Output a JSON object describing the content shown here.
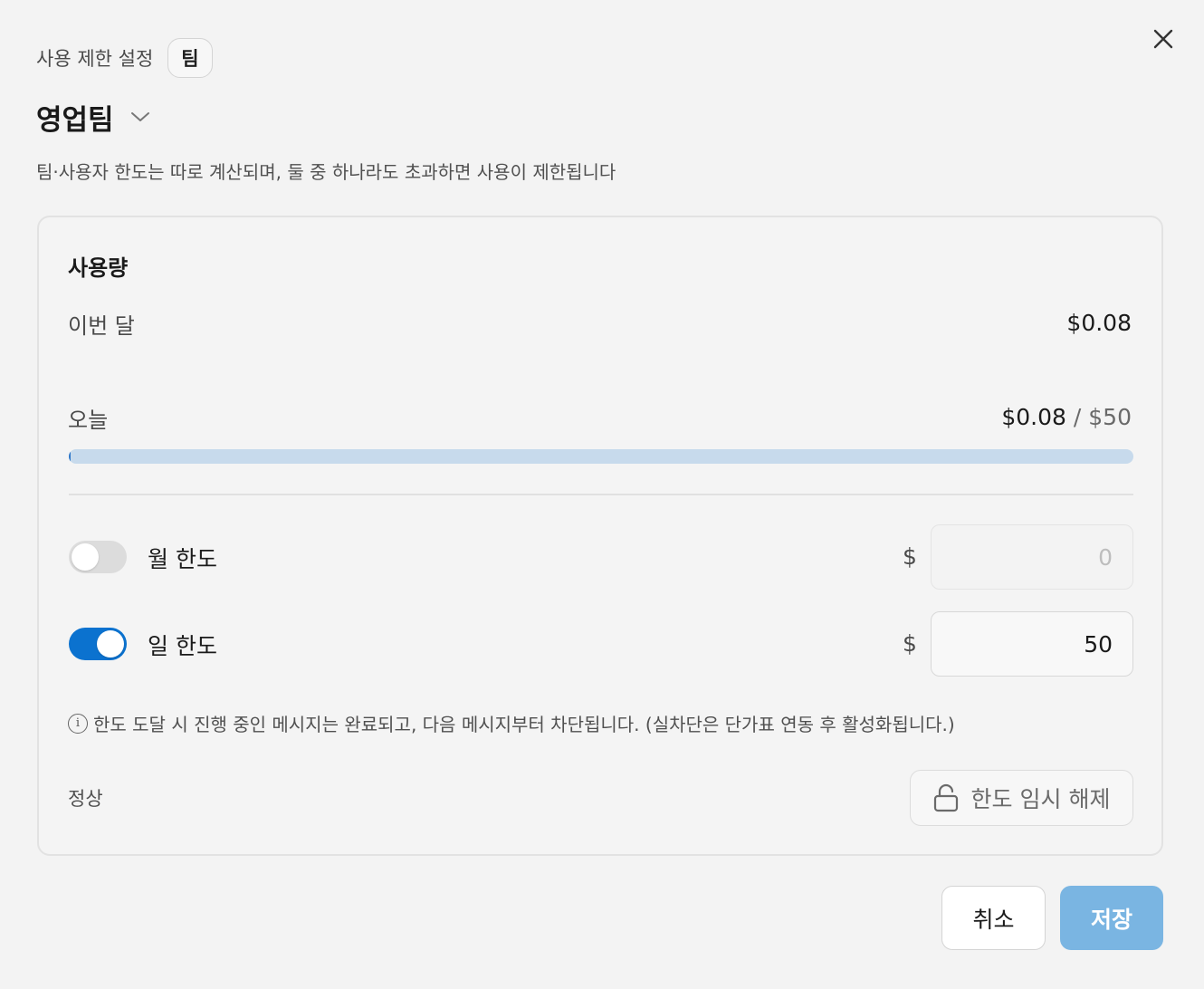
{
  "colors": {
    "accent": "#0b72cf",
    "progress_track": "#c7daec",
    "progress_fill": "#2e77c9",
    "save_button": "#7ab5e2"
  },
  "icons": {
    "close": "close-icon",
    "dropdown": "chevron-down-icon",
    "info": "info-icon",
    "unlock": "unlock-icon"
  },
  "header": {
    "title": "사용 제한 설정",
    "badge": "팀"
  },
  "team": {
    "name": "영업팀"
  },
  "description": "팀·사용자 한도는 따로 계산되며, 둘 중 하나라도 초과하면 사용이 제한됩니다",
  "usage": {
    "title": "사용량",
    "month_label": "이번 달",
    "month_value": "$0.08",
    "today_label": "오늘",
    "today_value": "$0.08",
    "today_separator": " / ",
    "today_limit": "$50",
    "today_progress_fraction": 0.0016
  },
  "limits": {
    "monthly": {
      "label": "월 한도",
      "enabled": false,
      "currency": "$",
      "value": "",
      "placeholder": "0"
    },
    "daily": {
      "label": "일 한도",
      "enabled": true,
      "currency": "$",
      "value": "50",
      "placeholder": "0"
    }
  },
  "note": "한도 도달 시 진행 중인 메시지는 완료되고, 다음 메시지부터 차단됩니다. (실차단은 단가표 연동 후 활성화됩니다.)",
  "status": "정상",
  "unlock_button": "한도 임시 해제",
  "footer": {
    "cancel": "취소",
    "save": "저장"
  }
}
